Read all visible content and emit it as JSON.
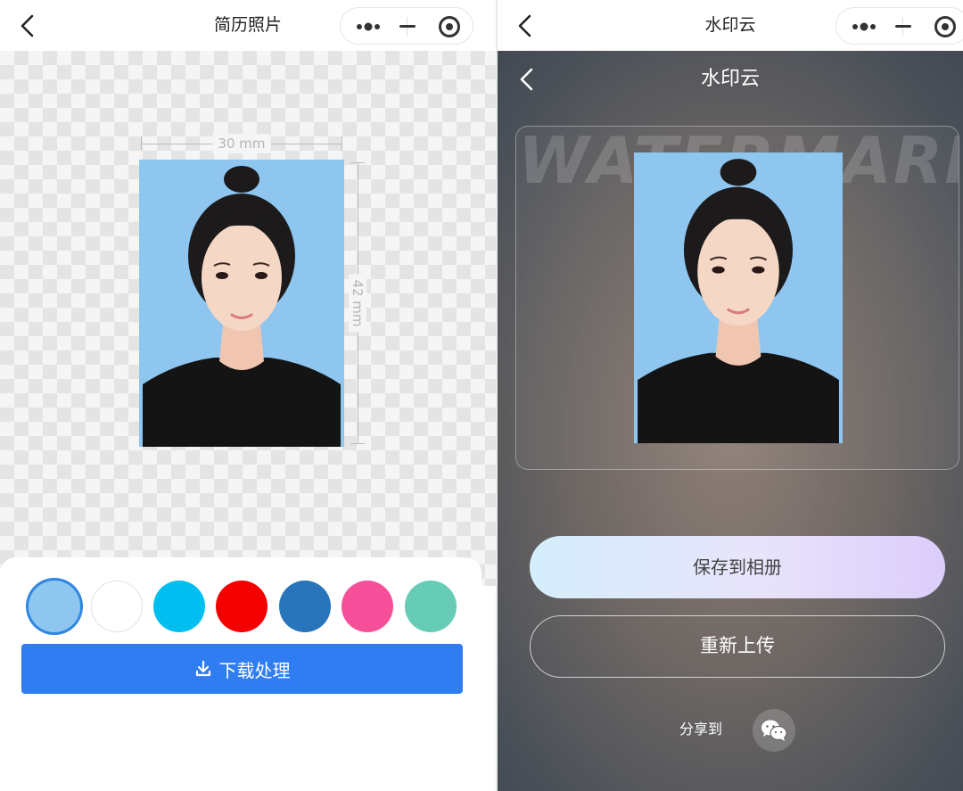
{
  "left": {
    "nav": {
      "title": "简历照片"
    },
    "dimensions": {
      "width_label": "30 mm",
      "height_label": "42 mm"
    },
    "photo": {
      "background": "#8fc6f0"
    },
    "swatches": [
      "#8fc6f0",
      "#ffffff",
      "#00bff0",
      "#f50000",
      "#2875bb",
      "#f64f9a",
      "#66ccb6"
    ],
    "selected_swatch": 0,
    "download_label": "下载处理"
  },
  "right": {
    "nav": {
      "title": "水印云"
    },
    "page_title": "水印云",
    "watermark_text": "WATERMARK",
    "save_label": "保存到相册",
    "reupload_label": "重新上传",
    "share_label": "分享到"
  },
  "icons": {
    "back": "chevron-left-icon",
    "more": "more-dots-icon",
    "minimize": "minimize-icon",
    "close": "target-circle-icon",
    "download": "download-icon",
    "wechat": "wechat-icon"
  },
  "colors": {
    "primary": "#2f7df0",
    "selected_ring": "#2f86e0"
  }
}
